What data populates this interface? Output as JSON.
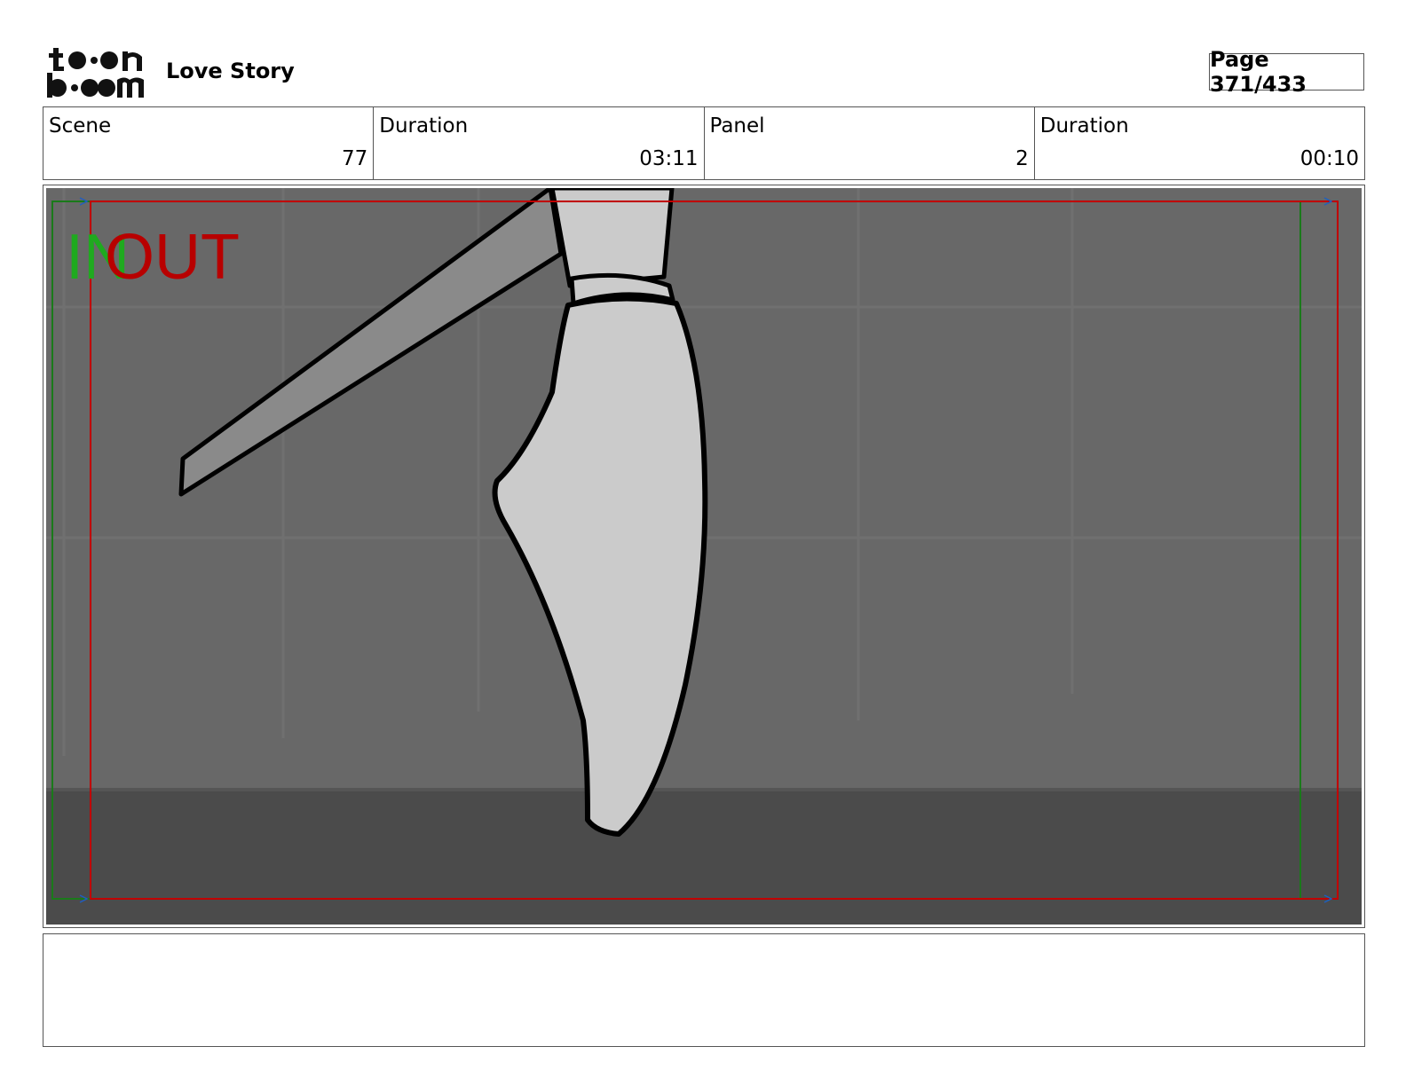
{
  "header": {
    "logo_text_top": "toon",
    "logo_text_bottom": "boom",
    "project_title": "Love Story",
    "page_label": "Page 371/433"
  },
  "info": {
    "scene_label": "Scene",
    "scene_value": "77",
    "scene_duration_label": "Duration",
    "scene_duration_value": "03:11",
    "panel_label": "Panel",
    "panel_value": "2",
    "panel_duration_label": "Duration",
    "panel_duration_value": "00:10"
  },
  "panel": {
    "in_marker": "IN",
    "out_marker": "OUT",
    "in_color": "#1faa1f",
    "out_color": "#b80000"
  },
  "notes": {
    "text": ""
  }
}
